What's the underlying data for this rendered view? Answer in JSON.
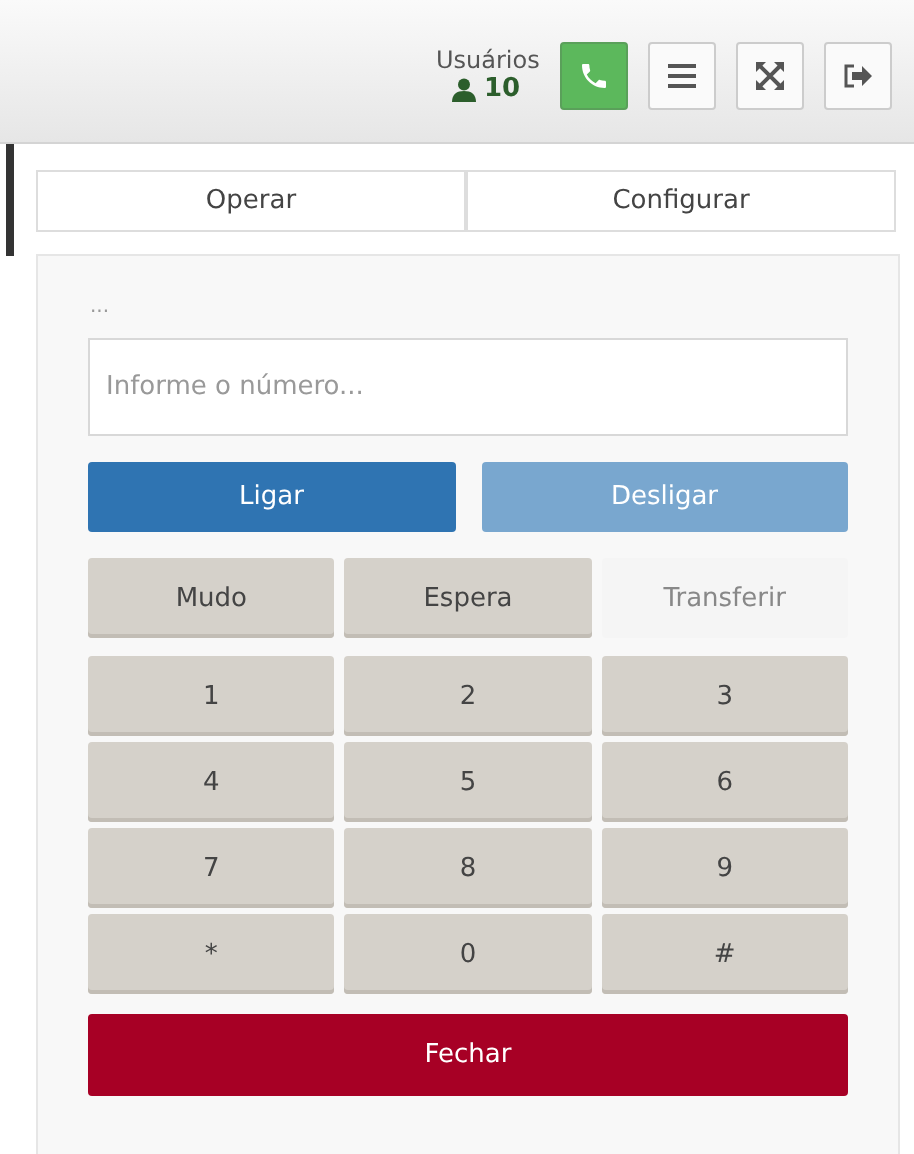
{
  "header": {
    "users_label": "Usuários",
    "users_count": "10",
    "buttons": [
      {
        "kind": "phone",
        "active": true
      },
      {
        "kind": "menu",
        "active": false
      },
      {
        "kind": "expand",
        "active": false
      },
      {
        "kind": "logout",
        "active": false
      }
    ]
  },
  "tabs": [
    {
      "label": "Operar"
    },
    {
      "label": "Configurar"
    }
  ],
  "status": "...",
  "number_field": {
    "placeholder": "Informe o número..."
  },
  "call_buttons": [
    {
      "label": "Ligar",
      "disabled": false
    },
    {
      "label": "Desligar",
      "disabled": true
    }
  ],
  "actions": [
    {
      "label": "Mudo",
      "disabled": false
    },
    {
      "label": "Espera",
      "disabled": false
    },
    {
      "label": "Transferir",
      "disabled": true
    }
  ],
  "keypad": [
    "1",
    "2",
    "3",
    "4",
    "5",
    "6",
    "7",
    "8",
    "9",
    "*",
    "0",
    "#"
  ],
  "close_button": "Fechar"
}
